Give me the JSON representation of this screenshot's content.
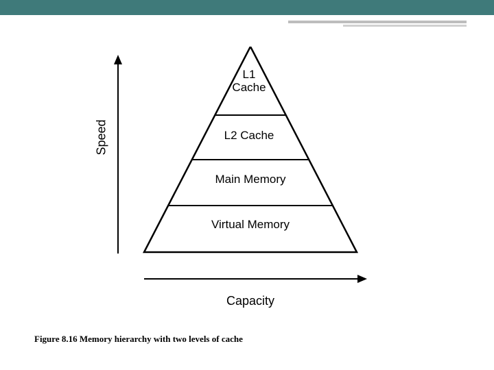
{
  "diagram": {
    "speed_axis_label": "Speed",
    "capacity_axis_label": "Capacity",
    "levels": {
      "l1": "L1\nCache",
      "l2": "L2 Cache",
      "main": "Main Memory",
      "virtual": "Virtual Memory"
    }
  },
  "caption": "Figure 8.16 Memory hierarchy with two levels of cache"
}
